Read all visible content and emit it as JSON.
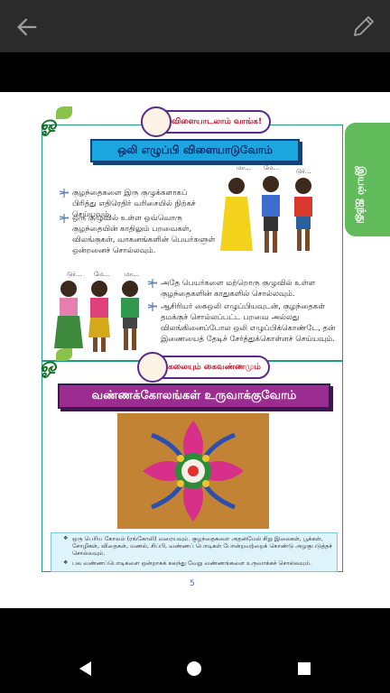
{
  "toolbar": {
    "back_icon": "arrow-left-icon",
    "edit_icon": "pencil-icon"
  },
  "side_tab": {
    "label": "இயல் ஐந்து"
  },
  "section1": {
    "badge": "விளையாடலாம் வாங்க!",
    "title": "ஒலி எழுப்பி விளையாடுவோம்",
    "bullets": [
      "குழந்தைகளை இரு குழுக்களாகப் பிரித்து எதிரெதிர் வரிசையில் நிற்கச் செய்யவும்.",
      "ஒரு குழுவில் உள்ள ஒவ்வொரு குழந்தையின் காதிலும் பறவைகள், விலங்குகள், வாகனங்களின் பெயர்களுள் ஒன்றனைச் சொல்லவும்.",
      "அதே பெயர்களை மற்றொரு குழுவில் உள்ள குழந்தைகளின் காதுகளில் சொல்லவும்.",
      "ஆசிரியர் கைஒலி எழுப்பியவுடன், குழந்தைகள் தமக்குச் சொல்லப்பட்ட பறவை அல்லது விலங்கினைப்போல ஒலி எழுப்பிக்கொண்டே, தன் இணையைத் தேடிச் சேர்த்துக்கொள்ளச் செய்யவும்."
    ],
    "sounds_top": [
      "மா...",
      "மே...",
      "டுர்..."
    ],
    "sounds_bottom": [
      "டுர்...",
      "மே...",
      "மா..."
    ]
  },
  "section2": {
    "badge": "கலையும் கைவண்ணமும்",
    "title": "வண்ணக்கோலங்கள் உருவாக்குவோம்",
    "notes": [
      "ஒரு பெரிய கோலம் (ரங்கோலி) வரையவும். குழந்தைகளை அதன்மேல் சிறு இலைகள், பூக்கள், சோழிகள், விதைகள், மணல், சிப்பி, வண்ணப் பொடிகள் போன்றவற்றைக் கொண்டு அழகுபடுத்தச் சொல்லவும்.",
      "பல வண்ணப்பொடிகளை ஒன்றாகக் கலந்து வேறு வண்ணங்களை உருவாக்கச் சொல்லவும்."
    ]
  },
  "page_number": "5",
  "nav": {
    "back": "back-triangle-icon",
    "home": "home-circle-icon",
    "recents": "recents-square-icon"
  },
  "colors": {
    "accent_blue": "#1aa7e0",
    "accent_purple": "#9a2d8f",
    "tab_green": "#62bb5a",
    "frame_teal": "#1e9a86"
  }
}
